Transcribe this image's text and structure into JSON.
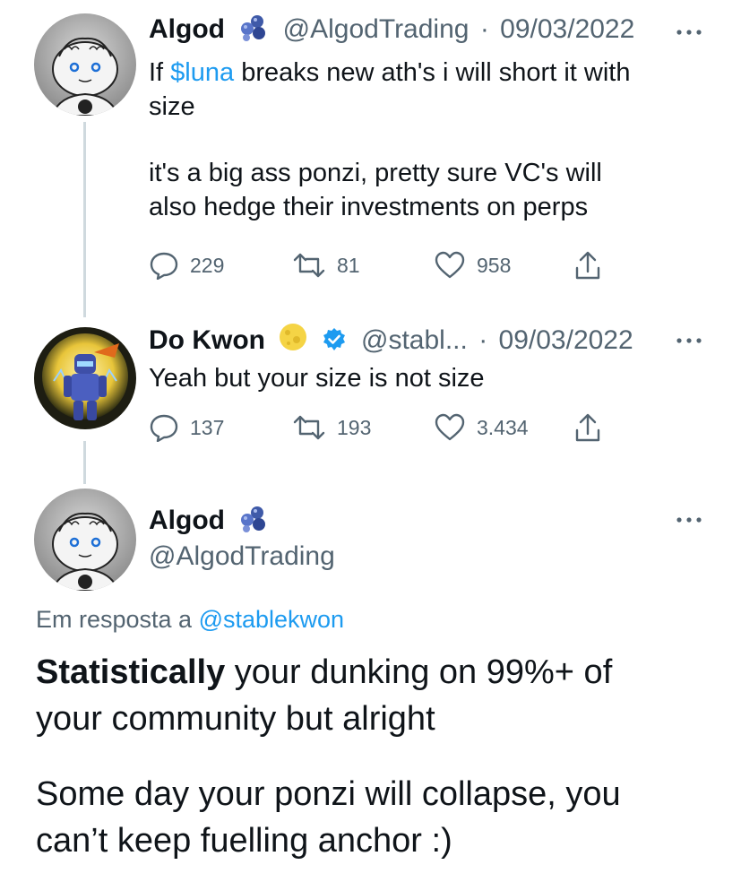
{
  "tweet1": {
    "name": "Algod",
    "name_icon": "cluster-emoji-icon",
    "handle": "@AlgodTrading",
    "separator": "·",
    "date": "09/03/2022",
    "text_prefix": "If ",
    "text_cashtag": "$luna",
    "text_line1_rest": " breaks new ath's i will short it with",
    "text_line2": "size",
    "text_para2_line1": "it's a big ass ponzi, pretty sure VC's will",
    "text_para2_line2": "also hedge their investments on perps",
    "replies": "229",
    "retweets": "81",
    "likes": "958"
  },
  "tweet2": {
    "name": "Do Kwon",
    "name_icon": "moon-emoji-icon",
    "verified_icon": "verified-badge-icon",
    "handle": "@stabl...",
    "separator": "·",
    "date": "09/03/2022",
    "text": "Yeah but your size is not size",
    "replies": "137",
    "retweets": "193",
    "likes": "3.434"
  },
  "main_tweet": {
    "name": "Algod",
    "name_icon": "cluster-emoji-icon",
    "handle": "@AlgodTrading",
    "reply_prefix": "Em resposta a ",
    "reply_to": "@stablekwon",
    "text_bold": "Statistically",
    "text_line1_rest": " your dunking on 99%+ of",
    "text_line2": "your community but alright",
    "text_para2_line1": "Some day your ponzi will collapse, you",
    "text_para2_line2": "can’t keep fuelling anchor :)"
  },
  "colors": {
    "link": "#1d9bf0",
    "muted": "#536471",
    "text": "#0f1419",
    "thread_line": "#cfd9de"
  }
}
